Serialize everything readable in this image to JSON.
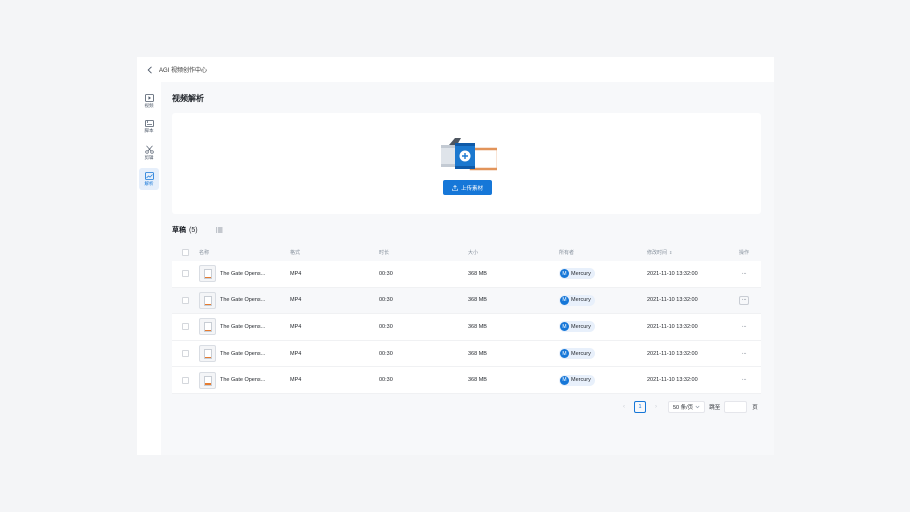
{
  "header": {
    "title": "AGI 视频创作中心"
  },
  "sidebar": {
    "items": [
      {
        "label": "视频",
        "active": false
      },
      {
        "label": "脚本",
        "active": false
      },
      {
        "label": "剪辑",
        "active": false
      },
      {
        "label": "解析",
        "active": true
      }
    ]
  },
  "page": {
    "title": "视频解析"
  },
  "upload": {
    "button_label": "上传素材"
  },
  "drafts": {
    "title": "草稿",
    "count": "(5)"
  },
  "table": {
    "headers": {
      "name": "名称",
      "format": "格式",
      "duration": "时长",
      "size": "大小",
      "owner": "所有者",
      "modified": "修改时间",
      "actions": "操作"
    },
    "rows": [
      {
        "name": "The Gate Opens...",
        "format": "MP4",
        "duration": "00:30",
        "size": "368 MB",
        "owner_initial": "M",
        "owner": "Mercury",
        "modified": "2021-11-10 13:32:00",
        "actions": "···"
      },
      {
        "name": "The Gate Opens...",
        "format": "MP4",
        "duration": "00:30",
        "size": "368 MB",
        "owner_initial": "M",
        "owner": "Mercury",
        "modified": "2021-11-10 13:32:00",
        "actions": "···"
      },
      {
        "name": "The Gate Opens...",
        "format": "MP4",
        "duration": "00:30",
        "size": "368 MB",
        "owner_initial": "M",
        "owner": "Mercury",
        "modified": "2021-11-10 13:32:00",
        "actions": "···"
      },
      {
        "name": "The Gate Opens...",
        "format": "MP4",
        "duration": "00:30",
        "size": "368 MB",
        "owner_initial": "M",
        "owner": "Mercury",
        "modified": "2021-11-10 13:32:00",
        "actions": "···"
      },
      {
        "name": "The Gate Opens...",
        "format": "MP4",
        "duration": "00:30",
        "size": "368 MB",
        "owner_initial": "M",
        "owner": "Mercury",
        "modified": "2021-11-10 13:32:00",
        "actions": "···"
      }
    ]
  },
  "pagination": {
    "current_page": "1",
    "page_size": "50 条/页",
    "jump_label": "跳至",
    "page_suffix": "页"
  },
  "colors": {
    "accent": "#1677d8",
    "orange": "#e67b2f"
  }
}
